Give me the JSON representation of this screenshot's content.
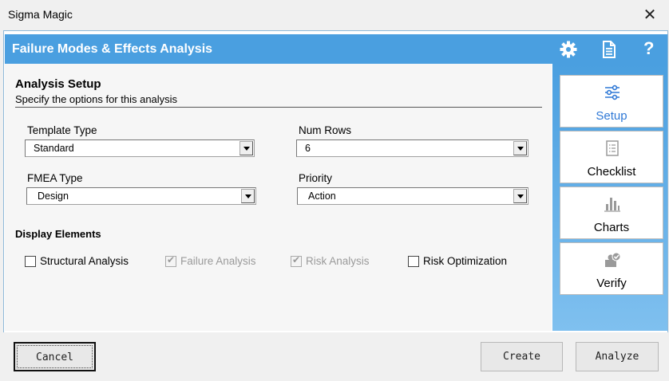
{
  "window": {
    "title": "Sigma Magic",
    "close_glyph": "✕"
  },
  "header": {
    "title": "Failure Modes & Effects Analysis",
    "icons": [
      "gear-icon",
      "document-icon",
      "help-icon"
    ],
    "help_glyph": "?"
  },
  "setup": {
    "title": "Analysis Setup",
    "subtitle": "Specify the options for this analysis",
    "template_type": {
      "label": "Template Type",
      "value": "Standard"
    },
    "num_rows": {
      "label": "Num Rows",
      "value": "6"
    },
    "fmea_type": {
      "label": "FMEA Type",
      "value": "Design"
    },
    "priority": {
      "label": "Priority",
      "value": "Action"
    },
    "display": {
      "title": "Display Elements",
      "items": [
        {
          "label": "Structural Analysis",
          "checked": false,
          "enabled": true
        },
        {
          "label": "Failure Analysis",
          "checked": true,
          "enabled": false
        },
        {
          "label": "Risk Analysis",
          "checked": true,
          "enabled": false
        },
        {
          "label": "Risk Optimization",
          "checked": false,
          "enabled": true
        }
      ]
    }
  },
  "nav": [
    {
      "label": "Setup",
      "icon": "sliders-icon",
      "active": true
    },
    {
      "label": "Checklist",
      "icon": "checklist-icon",
      "active": false
    },
    {
      "label": "Charts",
      "icon": "bar-chart-icon",
      "active": false
    },
    {
      "label": "Verify",
      "icon": "verify-icon",
      "active": false
    }
  ],
  "buttons": {
    "cancel": "Cancel",
    "create": "Create",
    "analyze": "Analyze"
  },
  "colors": {
    "accent": "#4a9fe0",
    "active_nav_text": "#2e78d6"
  }
}
